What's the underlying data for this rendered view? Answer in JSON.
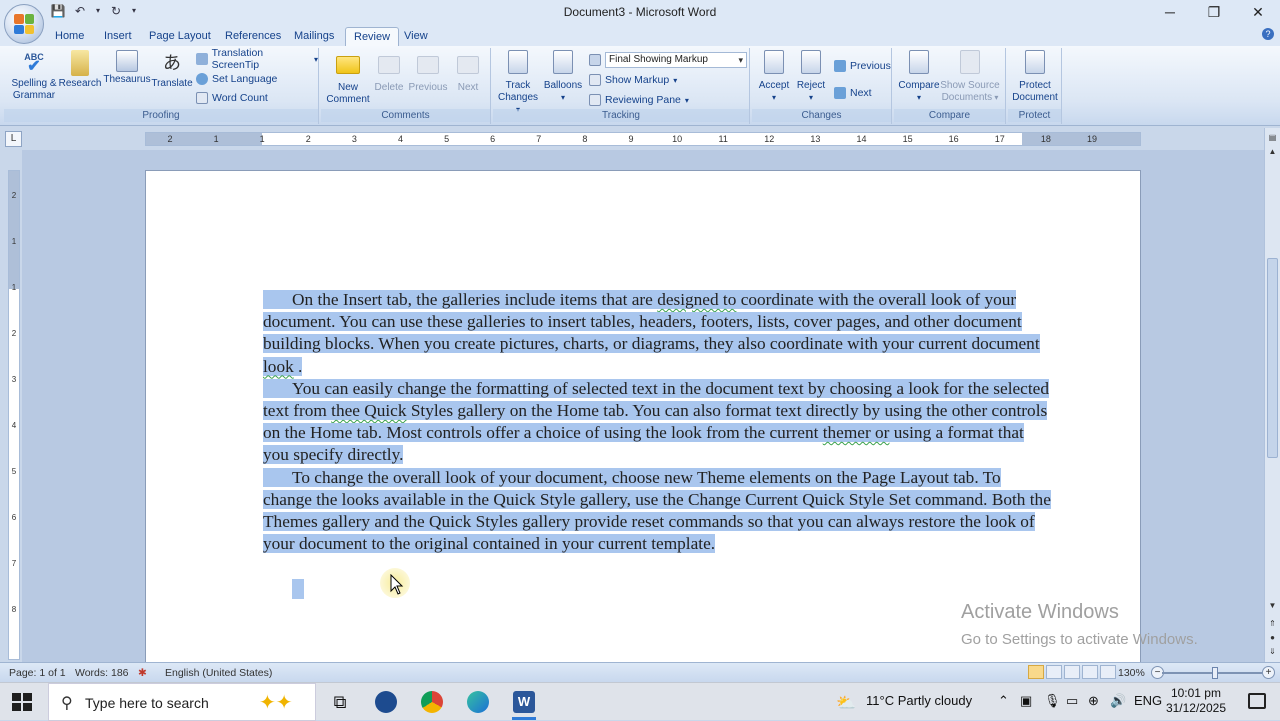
{
  "window": {
    "title": "Document3 - Microsoft Word",
    "minimize": "─",
    "maximize": "❐",
    "close": "✕"
  },
  "qat": {
    "save_icon": "save-icon",
    "undo_icon": "undo-icon",
    "redo_icon": "redo-icon"
  },
  "tabs": [
    {
      "label": "Home"
    },
    {
      "label": "Insert"
    },
    {
      "label": "Page Layout"
    },
    {
      "label": "References"
    },
    {
      "label": "Mailings"
    },
    {
      "label": "Review"
    },
    {
      "label": "View"
    }
  ],
  "ribbon": {
    "proofing": {
      "label": "Proofing",
      "spelling": "Spelling &",
      "spelling2": "Grammar",
      "research": "Research",
      "thesaurus": "Thesaurus",
      "translate": "Translate",
      "screentip": "Translation ScreenTip",
      "set_language": "Set Language",
      "word_count": "Word Count",
      "abc": "ABC"
    },
    "comments": {
      "label": "Comments",
      "new1": "New",
      "new2": "Comment",
      "delete": "Delete",
      "previous": "Previous",
      "next": "Next"
    },
    "tracking": {
      "label": "Tracking",
      "track1": "Track",
      "track2": "Changes",
      "balloons": "Balloons",
      "markup_combo": "Final Showing Markup",
      "show_markup": "Show Markup",
      "reviewing_pane": "Reviewing Pane"
    },
    "changes": {
      "label": "Changes",
      "accept": "Accept",
      "reject": "Reject",
      "previous": "Previous",
      "next": "Next"
    },
    "compare": {
      "label": "Compare",
      "compare": "Compare",
      "show_source1": "Show Source",
      "show_source2": "Documents"
    },
    "protect": {
      "label": "Protect",
      "protect1": "Protect",
      "protect2": "Document"
    }
  },
  "ruler": {
    "corner": "L",
    "h_ticks": [
      "2",
      "1",
      "1",
      "2",
      "3",
      "4",
      "5",
      "6",
      "7",
      "8",
      "9",
      "10",
      "11",
      "12",
      "13",
      "14",
      "15",
      "16",
      "17",
      "18",
      "19"
    ],
    "v_ticks": [
      "2",
      "1",
      "1",
      "2",
      "3",
      "4",
      "5",
      "6",
      "7",
      "8"
    ]
  },
  "document": {
    "p1": [
      "On the Insert tab, the galleries include items that are ",
      "designed  to",
      " coordinate with the overall look of your document. You can use these galleries to insert tables, headers, footers, lists, cover pages, and other document building blocks. When you create pictures, charts, or diagrams, they also coordinate with your current document ",
      "look",
      " ."
    ],
    "p2": [
      "You can easily change the formatting of selected text in the document text by choosing a look for the selected text from ",
      "thee  Quick",
      " Styles gallery on the Home tab. You can also format text directly by using the other controls on the Home tab. Most controls offer a choice of using the look from the current ",
      "themer  or",
      " using a format that you specify directly."
    ],
    "p3": [
      "To change the overall look of your document, choose new Theme elements on the Page Layout tab. To change the looks available in the Quick Style gallery, use the Change Current Quick Style Set command. Both the Themes gallery and the Quick Styles gallery provide reset commands so that you can always restore the look of your document to the original contained in your current template."
    ]
  },
  "watermark": {
    "line1": "Activate Windows",
    "line2": "Go to Settings to activate Windows."
  },
  "status": {
    "page": "Page: 1 of 1",
    "words": "Words: 186",
    "language": "English (United States)",
    "zoom": "130%",
    "zoom_minus": "−",
    "zoom_plus": "+"
  },
  "taskbar": {
    "search_placeholder": "Type here to search",
    "weather": "11°C  Partly cloudy",
    "lang": "ENG",
    "time": "10:01 pm",
    "date": "31/12/2025"
  },
  "colors": {
    "selection": "#a9c6ee",
    "ribbon_text": "#15428b",
    "word_blue": "#2b579a"
  }
}
